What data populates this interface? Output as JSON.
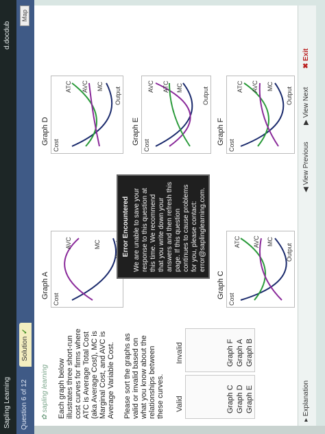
{
  "window": {
    "app_title": "Sapling Learning",
    "browser_label": "d.docdub"
  },
  "header": {
    "question_counter": "Question 6 of 12",
    "solution_tab": "Solution",
    "map_button": "Map"
  },
  "instructions": {
    "paragraph1": "Each graph below illustrates three short-run cost curves for firms where ATC is Average Total Cost (aka Average Cost), MC is Marginal Cost, and AVC is Average Variable Cost.",
    "paragraph2": "Please sort the graphs as valid or invalid based on what you know about the relationships between these curves."
  },
  "sorting": {
    "valid_label": "Valid",
    "invalid_label": "Invalid",
    "valid_items": [
      "Graph C",
      "Graph D",
      "Graph E"
    ],
    "invalid_items": [
      "Graph F",
      "Graph A",
      "Graph B"
    ]
  },
  "graphs": [
    {
      "title": "Graph A",
      "cost": "Cost",
      "output": "Output",
      "curves": [
        "MC",
        "AVC"
      ]
    },
    {
      "title": "Graph C",
      "cost": "Cost",
      "output": "Output",
      "curves": [
        "MC",
        "ATC",
        "AVC"
      ]
    },
    {
      "title": "Graph D",
      "cost": "Cost",
      "output": "Output",
      "curves": [
        "MC",
        "ATC",
        "AVC"
      ]
    },
    {
      "title": "Graph E",
      "cost": "Cost",
      "output": "Output",
      "curves": [
        "MC",
        "AVC",
        "ATC"
      ]
    },
    {
      "title": "Graph F",
      "cost": "Cost",
      "output": "Output",
      "curves": [
        "MC",
        "ATC",
        "AVC"
      ]
    }
  ],
  "error_popup": {
    "title": "Error Encountered",
    "body": "We are unable to save your response to this question at this time. We recommend that you write down your answers and then refresh this page. If this question continues to cause problems for you, please contact:",
    "email": "error@saplinglearning.com."
  },
  "footer": {
    "explanation": "Explanation",
    "view_previous": "View Previous",
    "view_next": "View Next",
    "exit": "Exit"
  },
  "colors": {
    "header": "#3f5a86",
    "mc": "#1a2a6c",
    "atc": "#2a9a3a",
    "avc": "#8a2a9a"
  }
}
